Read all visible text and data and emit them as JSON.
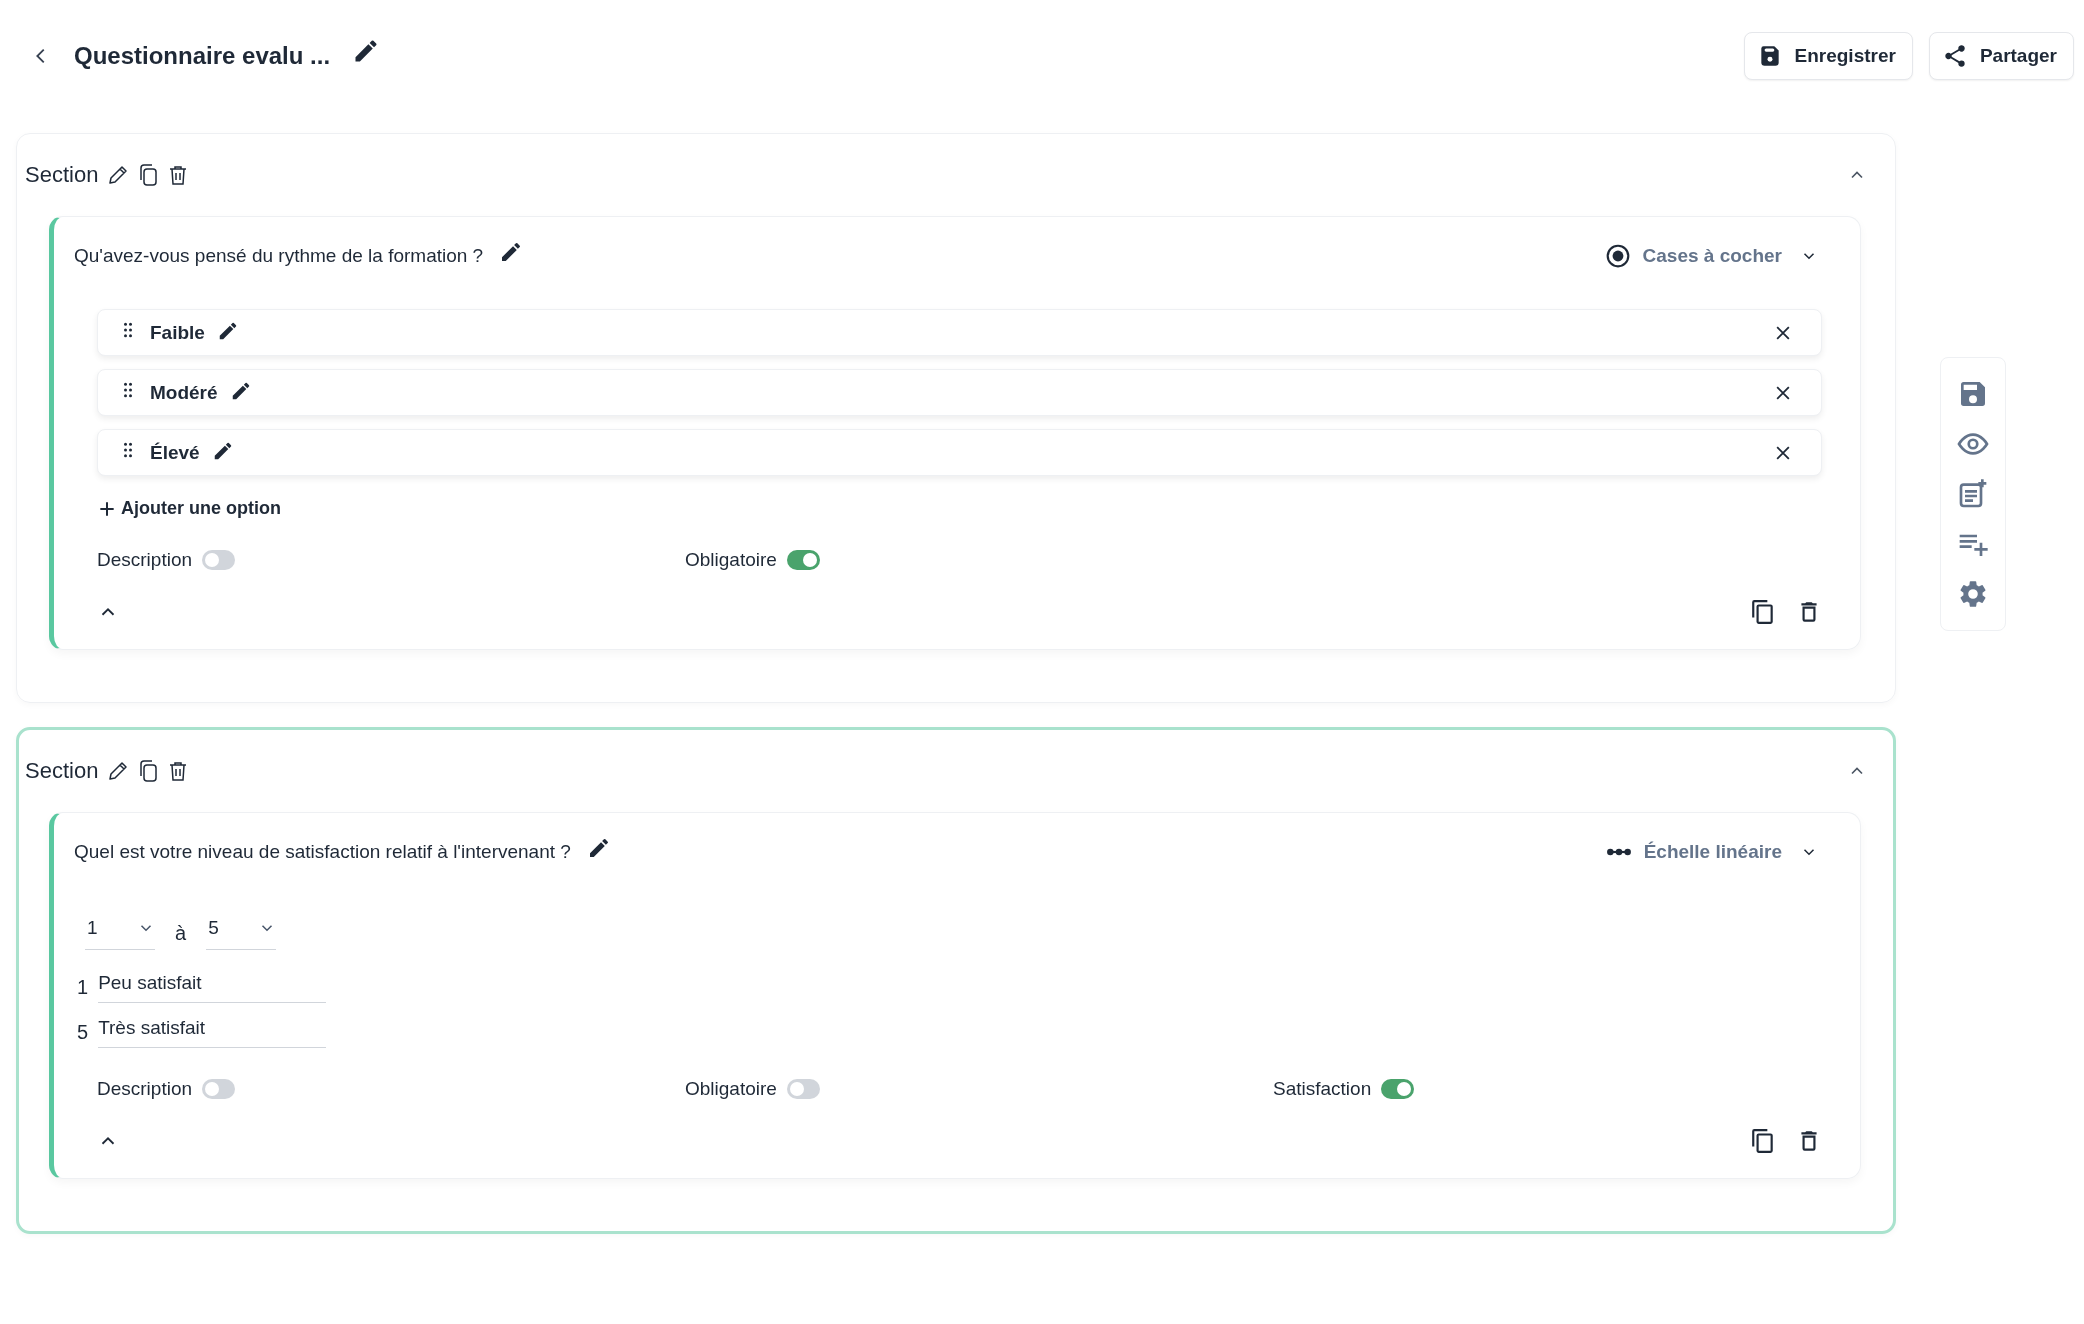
{
  "header": {
    "title": "Questionnaire evalu ...",
    "buttons": [
      {
        "label": "Enregistrer",
        "kind": "save"
      },
      {
        "label": "Partager",
        "kind": "share"
      }
    ]
  },
  "sections": [
    {
      "title": "Section",
      "highlighted": false,
      "expanded": true,
      "questions": [
        {
          "kind": "choice",
          "text": "Qu'avez-vous pensé du rythme de la formation ?",
          "type": {
            "kind": "radio",
            "label": "Cases à cocher"
          },
          "options": [
            {
              "label": "Faible"
            },
            {
              "label": "Modéré"
            },
            {
              "label": "Élevé"
            }
          ],
          "add_option": "Ajouter une option",
          "toggles": [
            {
              "label": "Description",
              "on": false
            },
            {
              "label": "Obligatoire",
              "on": true
            }
          ]
        }
      ]
    },
    {
      "title": "Section",
      "highlighted": true,
      "expanded": true,
      "questions": [
        {
          "kind": "scale",
          "text": "Quel est votre niveau de satisfaction relatif à l'intervenant ?",
          "type": {
            "kind": "linear",
            "label": "Échelle linéaire"
          },
          "scale": {
            "from": "1",
            "connector": "à",
            "to": "5",
            "labels": [
              {
                "value": "1",
                "text": "Peu satisfait"
              },
              {
                "value": "5",
                "text": "Très satisfait"
              }
            ]
          },
          "toggles": [
            {
              "label": "Description",
              "on": false
            },
            {
              "label": "Obligatoire",
              "on": false
            },
            {
              "label": "Satisfaction",
              "on": true
            }
          ]
        }
      ]
    }
  ]
}
